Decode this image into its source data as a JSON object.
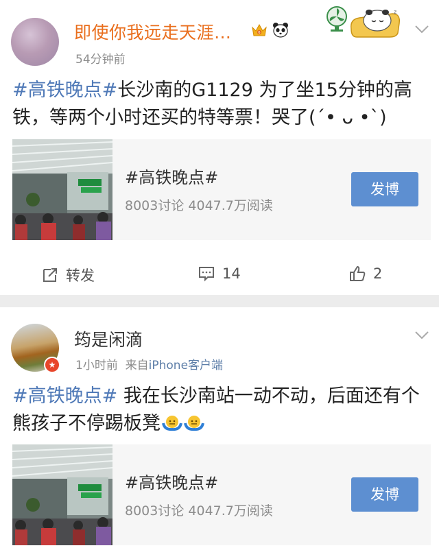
{
  "post1": {
    "user_name": "即使你我远走天涯…",
    "time": "54分钟前",
    "text_tag": "#高铁晚点#",
    "text_body": "长沙南的G1129 为了坐15分钟的高铁，等两个小时还买的特等票！哭了",
    "text_emoticon": "(´• ᴗ •`)",
    "card": {
      "title": "#高铁晚点#",
      "stats": "8003讨论   4047.7万阅读",
      "button": "发博"
    },
    "actions": {
      "forward": "转发",
      "comments": "14",
      "likes": "2"
    }
  },
  "post2": {
    "user_name": "筠是闲滴",
    "time": "1小时前",
    "source_prefix": "来自",
    "source": "iPhone客户端",
    "text_tag": "#高铁晚点#",
    "text_body": " 我在长沙南站一动不动，后面还有个熊孩子不停踢板凳",
    "card": {
      "title": "#高铁晚点#",
      "stats": "8003讨论   4047.7万阅读",
      "button": "发博"
    }
  },
  "icons": {
    "forward": "forward-icon",
    "comment": "comment-icon",
    "like": "thumbs-up-icon",
    "more": "chevron-down-icon",
    "vip": "vip-crown-icon",
    "panda": "panda-icon",
    "verified": "verified-badge-icon",
    "shrug": "shrug-emoji-icon"
  },
  "colors": {
    "tag_blue": "#4f79b7",
    "vip_name": "#e96e1d",
    "button_blue": "#5d8fd1"
  }
}
